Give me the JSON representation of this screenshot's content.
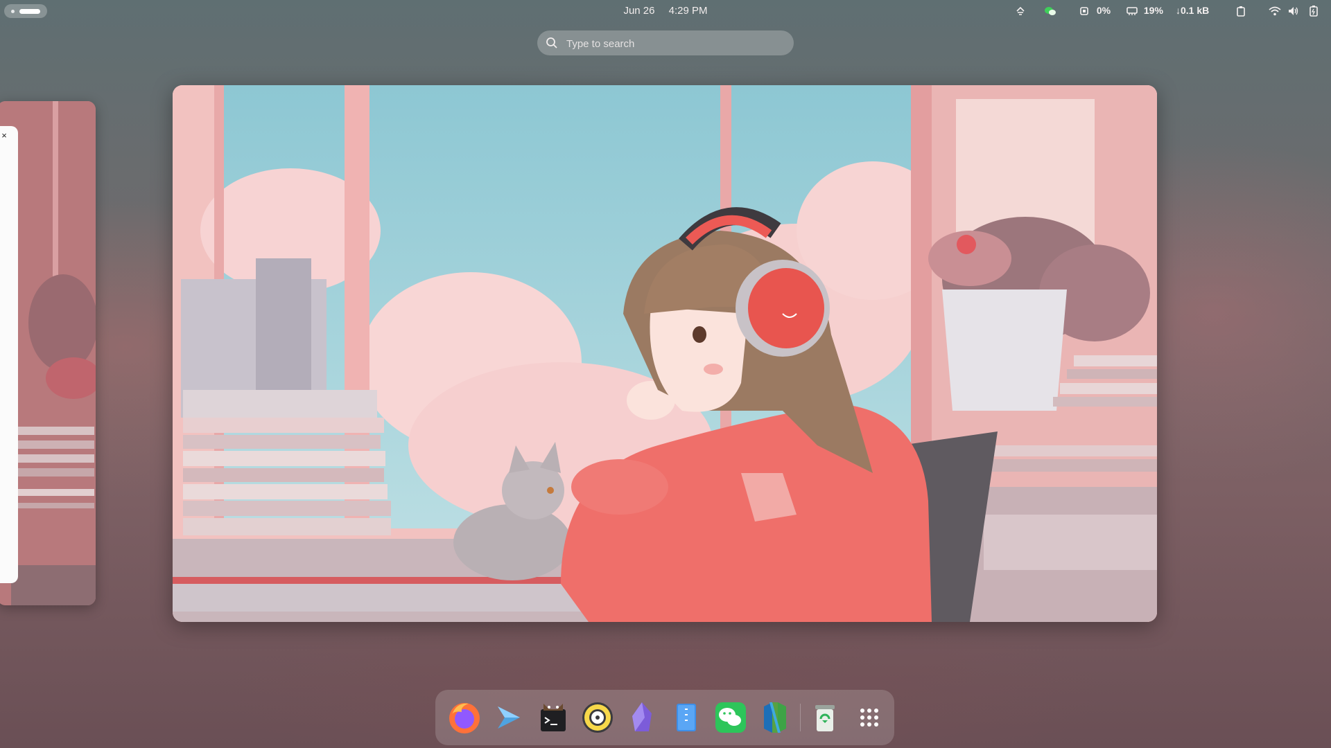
{
  "topbar": {
    "date": "Jun 26",
    "time": "4:29 PM",
    "cpu": "0%",
    "memory": "19%",
    "network": "0.1 kB"
  },
  "search": {
    "placeholder": "Type to search"
  },
  "left_window": {
    "close_label": "×"
  },
  "dock": {
    "apps": [
      {
        "name": "Firefox",
        "icon": "firefox-icon"
      },
      {
        "name": "Code Editor",
        "icon": "code-editor-icon"
      },
      {
        "name": "Terminal",
        "icon": "terminal-icon"
      },
      {
        "name": "Music Player",
        "icon": "music-player-icon"
      },
      {
        "name": "Obsidian",
        "icon": "obsidian-icon"
      },
      {
        "name": "Files",
        "icon": "files-icon"
      },
      {
        "name": "WeChat",
        "icon": "wechat-icon"
      },
      {
        "name": "Neovim",
        "icon": "neovim-icon"
      },
      {
        "name": "Trash",
        "icon": "trash-icon"
      },
      {
        "name": "Show Apps",
        "icon": "app-grid-icon"
      }
    ]
  },
  "colors": {
    "accent": "#e65c5c",
    "sky": "#9ccfd8",
    "sweater": "#ef6f6a"
  }
}
